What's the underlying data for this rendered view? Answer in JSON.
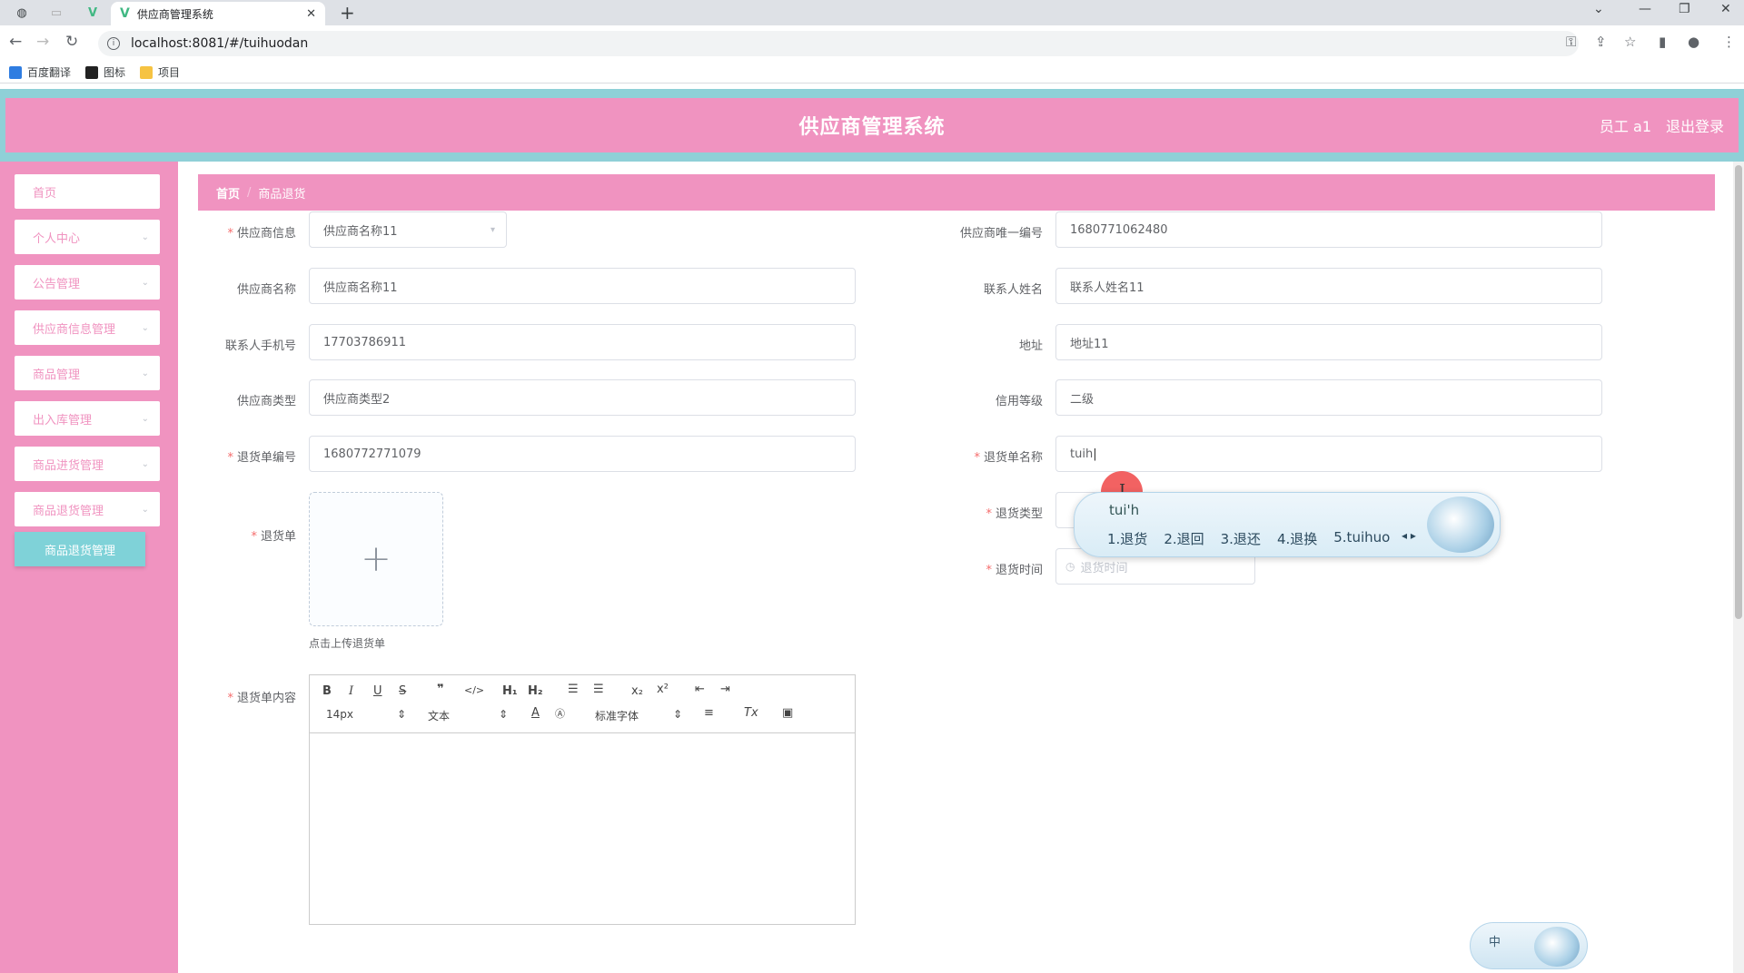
{
  "browser": {
    "tab_title": "供应商管理系统",
    "url": "localhost:8081/#/tuihuodan",
    "bookmarks": [
      "百度翻译",
      "图标",
      "项目"
    ]
  },
  "header": {
    "system_name": "供应商管理系统",
    "user": "员工 a1",
    "logout": "退出登录"
  },
  "sidebar": {
    "items": [
      "首页",
      "个人中心",
      "公告管理",
      "供应商信息管理",
      "商品管理",
      "出入库管理",
      "商品进货管理",
      "商品退货管理"
    ],
    "active_subitem": "商品退货管理"
  },
  "breadcrumb": {
    "home": "首页",
    "current": "商品退货"
  },
  "form": {
    "supplier_info": {
      "label": "供应商信息",
      "value": "供应商名称11"
    },
    "supplier_unique_no": {
      "label": "供应商唯一编号",
      "value": "1680771062480"
    },
    "supplier_name": {
      "label": "供应商名称",
      "value": "供应商名称11"
    },
    "contact_name": {
      "label": "联系人姓名",
      "value": "联系人姓名11"
    },
    "contact_phone": {
      "label": "联系人手机号",
      "value": "17703786911"
    },
    "address": {
      "label": "地址",
      "value": "地址11"
    },
    "supplier_type": {
      "label": "供应商类型",
      "value": "供应商类型2"
    },
    "credit_level": {
      "label": "信用等级",
      "value": "二级"
    },
    "return_no": {
      "label": "退货单编号",
      "value": "1680772771079"
    },
    "return_name": {
      "label": "退货单名称",
      "value": "tuih"
    },
    "return_type": {
      "label": "退货类型"
    },
    "return_time": {
      "label": "退货时间",
      "placeholder": "退货时间"
    },
    "return_doc": {
      "label": "退货单",
      "tip": "点击上传退货单"
    },
    "return_content": {
      "label": "退货单内容"
    }
  },
  "editor": {
    "font_size": "14px",
    "header_select": "文本",
    "font_family": "标准字体"
  },
  "ime": {
    "composition": "tui'h",
    "candidates": [
      "1.退货",
      "2.退回",
      "3.退还",
      "4.退换",
      "5.tuihuo"
    ],
    "status": "中"
  }
}
